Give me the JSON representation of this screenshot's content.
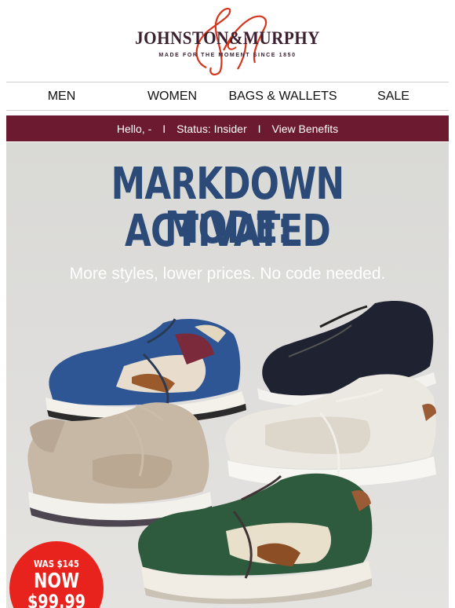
{
  "header": {
    "brand": "JOHNSTON&MURPHY",
    "tagline": "MADE FOR THE MOMENT SINCE 1850",
    "logo_icon": "jm-script-monogram"
  },
  "nav": {
    "items": [
      {
        "label": "MEN"
      },
      {
        "label": "WOMEN"
      },
      {
        "label": "BAGS & WALLETS"
      },
      {
        "label": "SALE"
      }
    ]
  },
  "member_bar": {
    "greeting": "Hello, -",
    "separator": "I",
    "status": "Status: Insider",
    "benefits": "View Benefits"
  },
  "hero": {
    "headline_line1": "MARKDOWN MODE:",
    "headline_line2": "ACTIVATED",
    "subhead": "More styles, lower prices. No code needed.",
    "badge": {
      "was": "WAS $145",
      "now": "NOW",
      "price": "$99.99"
    }
  },
  "colors": {
    "burgundy": "#6b1a30",
    "headline_blue": "#2b4a78",
    "badge_red": "#e8231d",
    "logo_red": "#d4351c"
  }
}
